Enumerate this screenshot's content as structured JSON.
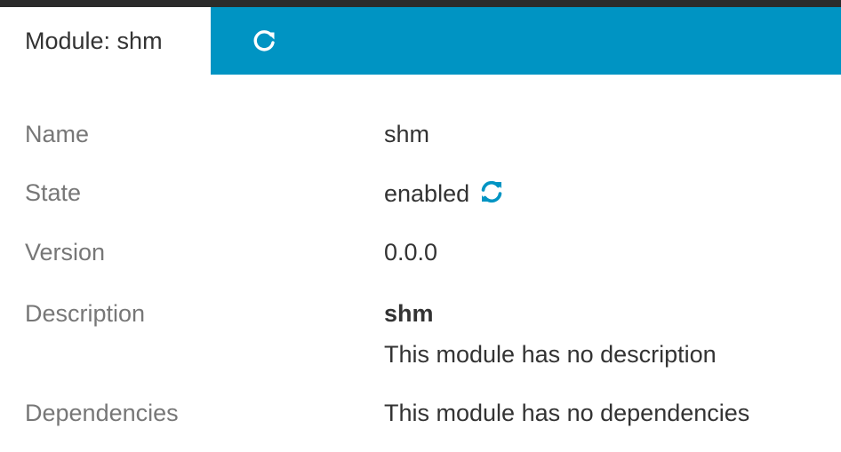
{
  "tab": {
    "title": "Module: shm",
    "refresh_icon": "refresh-icon"
  },
  "colors": {
    "accent": "#0094c3",
    "label": "#777777",
    "value": "#333333"
  },
  "details": {
    "name_label": "Name",
    "name_value": "shm",
    "state_label": "State",
    "state_value": "enabled",
    "state_icon": "sync-icon",
    "version_label": "Version",
    "version_value": "0.0.0",
    "description_label": "Description",
    "description_title": "shm",
    "description_text": "This module has no description",
    "dependencies_label": "Dependencies",
    "dependencies_value": "This module has no dependencies"
  }
}
